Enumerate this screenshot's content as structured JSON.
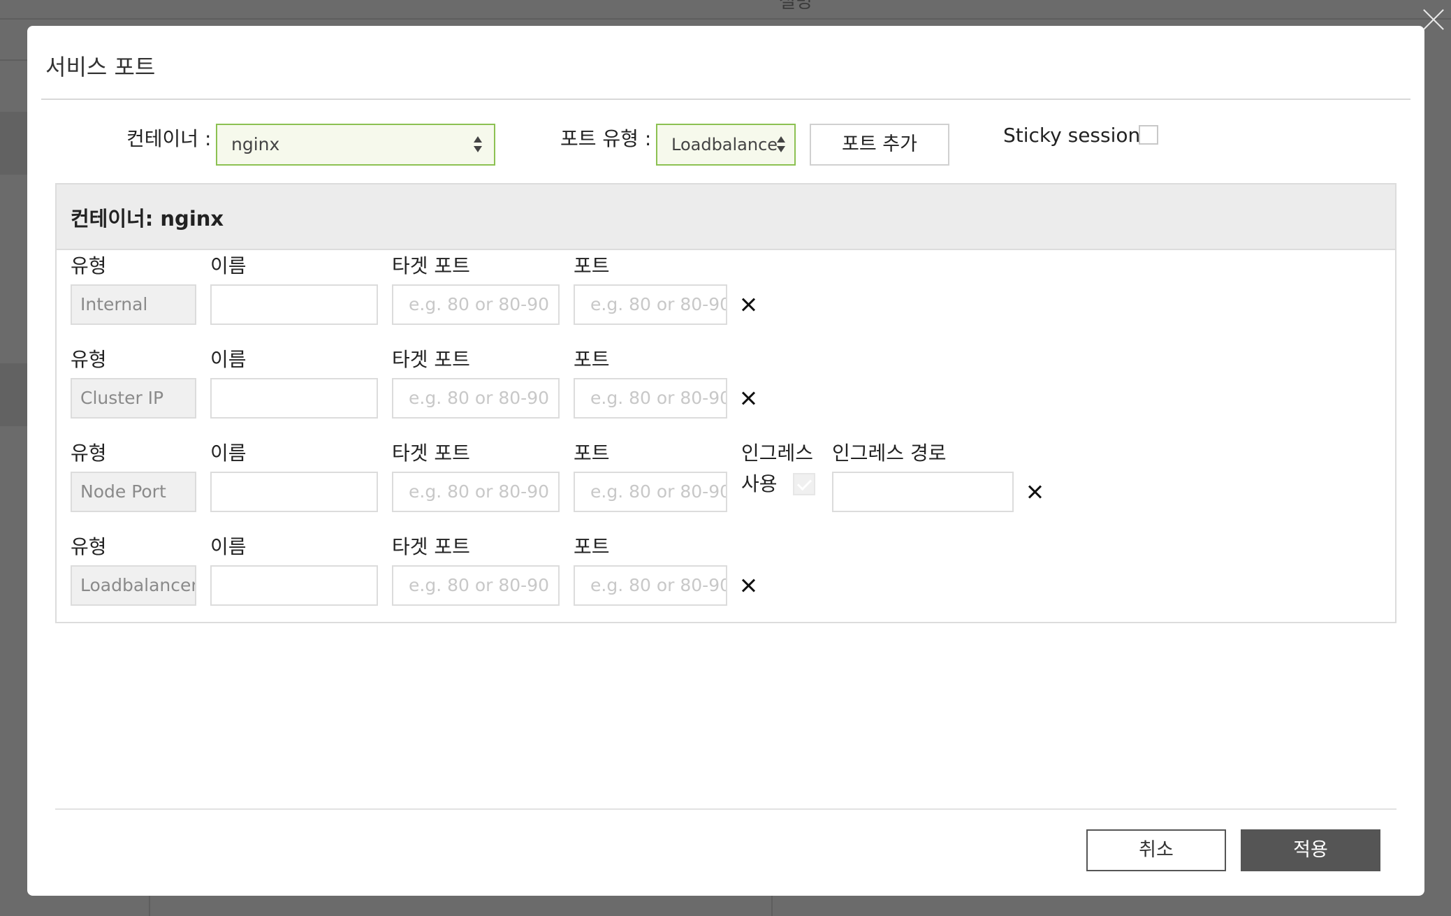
{
  "background": {
    "title": "설명"
  },
  "modal": {
    "title": "서비스 포트",
    "container_label": "컨테이너 :",
    "container_value": "nginx",
    "port_type_label": "포트 유형 :",
    "port_type_value": "Loadbalance",
    "add_port_button": "포트 추가",
    "sticky_session_label": "Sticky session",
    "panel_title": "컨테이너: nginx",
    "columns": {
      "type": "유형",
      "name": "이름",
      "target_port": "타겟 포트",
      "port": "포트",
      "ingress": "인그레스",
      "ingress_use": "사용",
      "ingress_path": "인그레스 경로"
    },
    "port_placeholder": "e.g. 80 or 80-90",
    "rows": [
      {
        "type": "Internal"
      },
      {
        "type": "Cluster IP"
      },
      {
        "type": "Node Port",
        "ingress_checked": true
      },
      {
        "type": "Loadbalancer"
      }
    ],
    "cancel_button": "취소",
    "apply_button": "적용"
  },
  "colors": {
    "accent_border": "#8cc152",
    "primary_button": "#555555",
    "overlay": "#6b6b6b"
  }
}
